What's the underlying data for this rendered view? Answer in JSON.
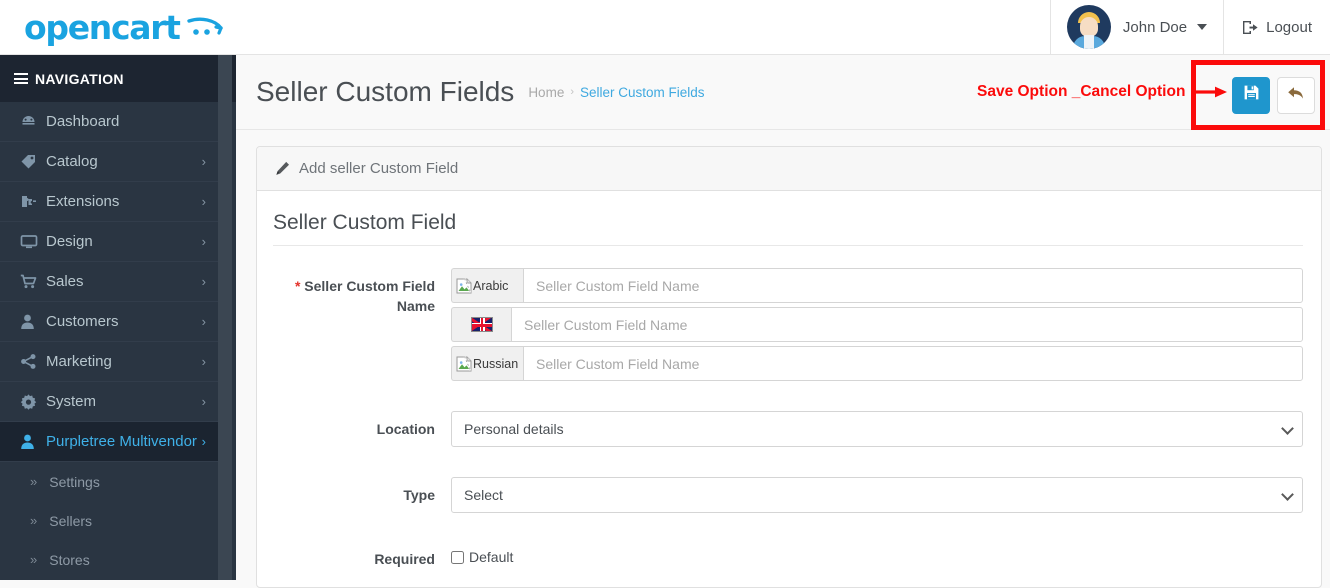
{
  "brand": {
    "name": "opencart",
    "cart_icon": "cart-swoosh-icon",
    "accent_color": "#1aa3e0"
  },
  "topbar": {
    "user_name": "John Doe",
    "user_avatar": "avatar",
    "caret_icon": "chevron-down-icon",
    "logout_label": "Logout",
    "logout_icon": "logout-icon"
  },
  "sidebar": {
    "header": "NAVIGATION",
    "header_icon": "hamburger-icon",
    "items": [
      {
        "label": "Dashboard",
        "icon": "dashboard-icon",
        "arrow": "",
        "active": false
      },
      {
        "label": "Catalog",
        "icon": "tag-icon",
        "arrow": "›",
        "active": false
      },
      {
        "label": "Extensions",
        "icon": "puzzle-icon",
        "arrow": "›",
        "active": false
      },
      {
        "label": "Design",
        "icon": "monitor-icon",
        "arrow": "›",
        "active": false
      },
      {
        "label": "Sales",
        "icon": "shopping-cart-icon",
        "arrow": "›",
        "active": false
      },
      {
        "label": "Customers",
        "icon": "user-icon",
        "arrow": "›",
        "active": false
      },
      {
        "label": "Marketing",
        "icon": "share-icon",
        "arrow": "›",
        "active": false
      },
      {
        "label": "System",
        "icon": "gear-icon",
        "arrow": "›",
        "active": false
      },
      {
        "label": "Purpletree Multivendor",
        "icon": "user-icon",
        "arrow": "›",
        "active": true
      }
    ],
    "sub_items": [
      {
        "label": "Settings",
        "chevron": "»"
      },
      {
        "label": "Sellers",
        "chevron": "»"
      },
      {
        "label": "Stores",
        "chevron": "»"
      }
    ]
  },
  "page": {
    "title": "Seller Custom Fields",
    "breadcrumb": {
      "home": "Home",
      "separator": "›",
      "current": "Seller Custom Fields"
    },
    "annotation": {
      "text": "Save Option _Cancel Option",
      "arrow_icon": "right-arrow-icon",
      "color": "#fb0b0b"
    },
    "actions": {
      "save": {
        "label": "",
        "icon": "save-floppy-icon",
        "color": "#1f96cd"
      },
      "back": {
        "label": "",
        "icon": "back-reply-icon",
        "color": "#ffffff"
      }
    }
  },
  "panel": {
    "header": "Add seller Custom Field",
    "header_icon": "pencil-icon",
    "legend": "Seller Custom Field",
    "fields": {
      "name": {
        "label": "Seller Custom Field Name",
        "required_marker": "*",
        "rows": [
          {
            "language": "Arabic",
            "icon": "broken-image-icon",
            "placeholder": "Seller Custom Field Name",
            "value": ""
          },
          {
            "language": "English",
            "icon": "uk-flag-icon",
            "placeholder": "Seller Custom Field Name",
            "value": ""
          },
          {
            "language": "Russian",
            "icon": "broken-image-icon",
            "placeholder": "Seller Custom Field Name",
            "value": ""
          }
        ]
      },
      "location": {
        "label": "Location",
        "selected": "Personal details",
        "options": [
          "Personal details"
        ],
        "chevron_icon": "chevron-down-icon"
      },
      "type": {
        "label": "Type",
        "selected": "Select",
        "options": [
          "Select"
        ],
        "chevron_icon": "chevron-down-icon"
      },
      "required": {
        "label": "Required",
        "checkbox_label": "Default",
        "checked": false
      }
    }
  }
}
